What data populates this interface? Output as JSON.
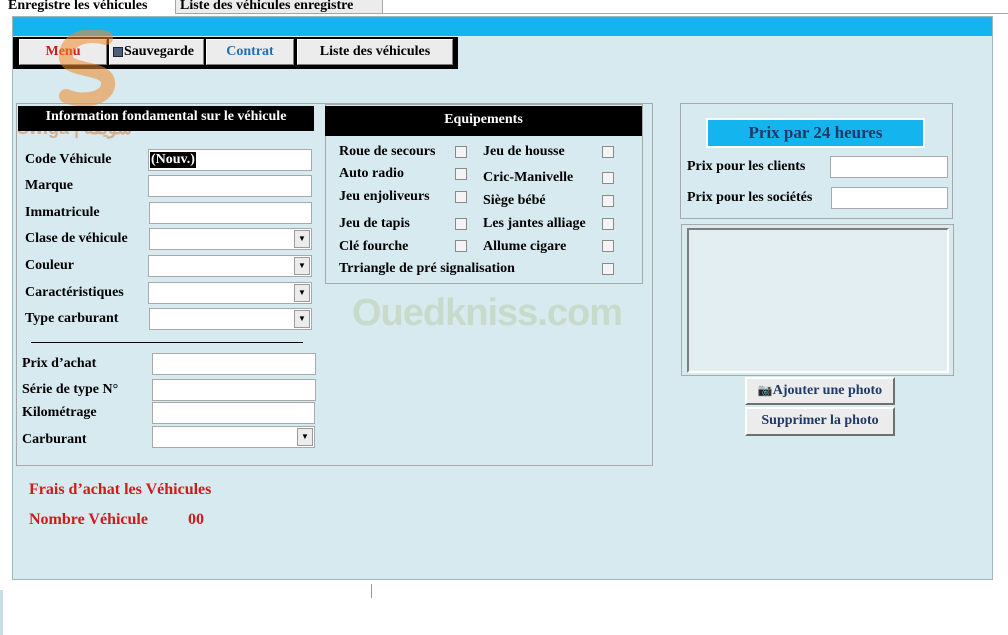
{
  "tabs": [
    {
      "label": "Enregistre les véhicules"
    },
    {
      "label": "Liste des véhicules enregistre"
    }
  ],
  "toolbar": {
    "menu": "Menu",
    "save": "Sauvegarde",
    "contract": "Contrat",
    "vehicle_list": "Liste des véhicules"
  },
  "info_section": {
    "title": "Information fondamental sur le véhicule",
    "fields": {
      "code_label": "Code Véhicule",
      "code_value": "(Nouv.)",
      "brand_label": "Marque",
      "plate_label": "Immatricule",
      "class_label": "Clase de véhicule",
      "color_label": "Couleur",
      "features_label": "Caractéristiques",
      "fuel_type_label": "Type carburant",
      "price_label": "Prix d’achat",
      "serial_label": "Série de type N°",
      "mileage_label": "Kilométrage",
      "fuel_label": "Carburant"
    }
  },
  "equipment": {
    "title": "Equipements",
    "items": [
      "Roue de secours",
      "Jeu de housse",
      "Auto radio",
      "Cric-Manivelle",
      "Jeu enjoliveurs",
      "Siège bébé",
      "Jeu de tapis",
      "Les jantes alliage",
      "Clé fourche",
      "Allume cigare",
      "Trriangle de pré signalisation"
    ]
  },
  "pricing": {
    "title": "Prix par 24 heures",
    "clients_label": "Prix pour les clients",
    "companies_label": "Prix pour les sociétés"
  },
  "photo": {
    "add_label": "Ajouter une photo",
    "remove_label": "Supprimer la photo"
  },
  "summary": {
    "fees_label": "Frais d’achat les Véhicules",
    "count_label": "Nombre Véhicule",
    "count_value": "00"
  },
  "watermarks": {
    "logo_text": "Swiga | سويقة",
    "site_text": "Ouedkniss.com"
  },
  "colors": {
    "panel_bg": "#d6eaf0",
    "top_bar": "#14b4ee",
    "price_header": "#14b4ee",
    "red_text": "#d11a1a",
    "contract_blue": "#1f6fb3"
  }
}
